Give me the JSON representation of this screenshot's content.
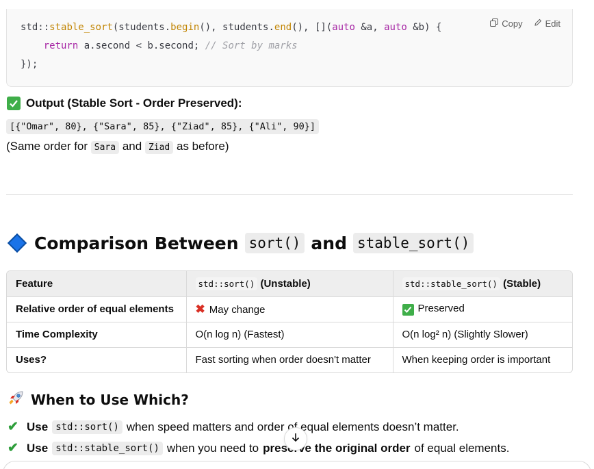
{
  "code_block": {
    "copy_label": "Copy",
    "edit_label": "Edit",
    "line1": {
      "ns": "std::",
      "fn": "stable_sort",
      "a": "(students.",
      "b": "begin",
      "c": "(), students.",
      "d": "end",
      "e": "(), [](",
      "k1": "auto",
      "f": " &a, ",
      "k2": "auto",
      "g": " &b) {"
    },
    "line2": {
      "indent": "    ",
      "kw": "return",
      "body": " a.second < b.second; ",
      "comment": "// Sort by marks"
    },
    "line3": "});"
  },
  "output": {
    "heading": "Output (Stable Sort - Order Preserved):",
    "result": "[{\"Omar\", 80}, {\"Sara\", 85}, {\"Ziad\", 85}, {\"Ali\", 90}]",
    "note_prefix": "(Same order for",
    "note_code1": "Sara",
    "note_mid": "and",
    "note_code2": "Ziad",
    "note_suffix": "as before)"
  },
  "comparison": {
    "heading_text": "Comparison Between",
    "code1": "sort()",
    "and": "and",
    "code2": "stable_sort()",
    "table": {
      "headers": {
        "feature": "Feature",
        "sort_code": "std::sort()",
        "sort_tag": "(Unstable)",
        "stable_code": "std::stable_sort()",
        "stable_tag": "(Stable)"
      },
      "rows": [
        {
          "feature": "Relative order of equal elements",
          "sort": "May change",
          "stable": "Preserved"
        },
        {
          "feature": "Time Complexity",
          "sort": "O(n log n) (Fastest)",
          "stable": "O(n log² n) (Slightly Slower)"
        },
        {
          "feature": "Uses?",
          "sort": "Fast sorting when order doesn't matter",
          "stable": "When keeping order is important"
        }
      ]
    }
  },
  "when": {
    "heading": "When to Use Which?",
    "items": [
      {
        "use": "Use",
        "code": "std::sort()",
        "text": "when speed matters and order of equal elements doesn’t matter.",
        "bold": "",
        "tail": ""
      },
      {
        "use": "Use",
        "code": "std::stable_sort()",
        "text": "when you need to",
        "bold": "preserve the original order",
        "tail": "of equal elements."
      }
    ]
  },
  "colors": {
    "accent_check": "#3fae49",
    "diamond": "#1a73e8",
    "x_mark": "#d93025"
  },
  "icons": [
    "copy-icon",
    "edit-icon",
    "check-box-icon",
    "diamond-icon",
    "x-mark-icon",
    "rocket-icon",
    "check-mark-icon",
    "arrow-down-icon"
  ]
}
